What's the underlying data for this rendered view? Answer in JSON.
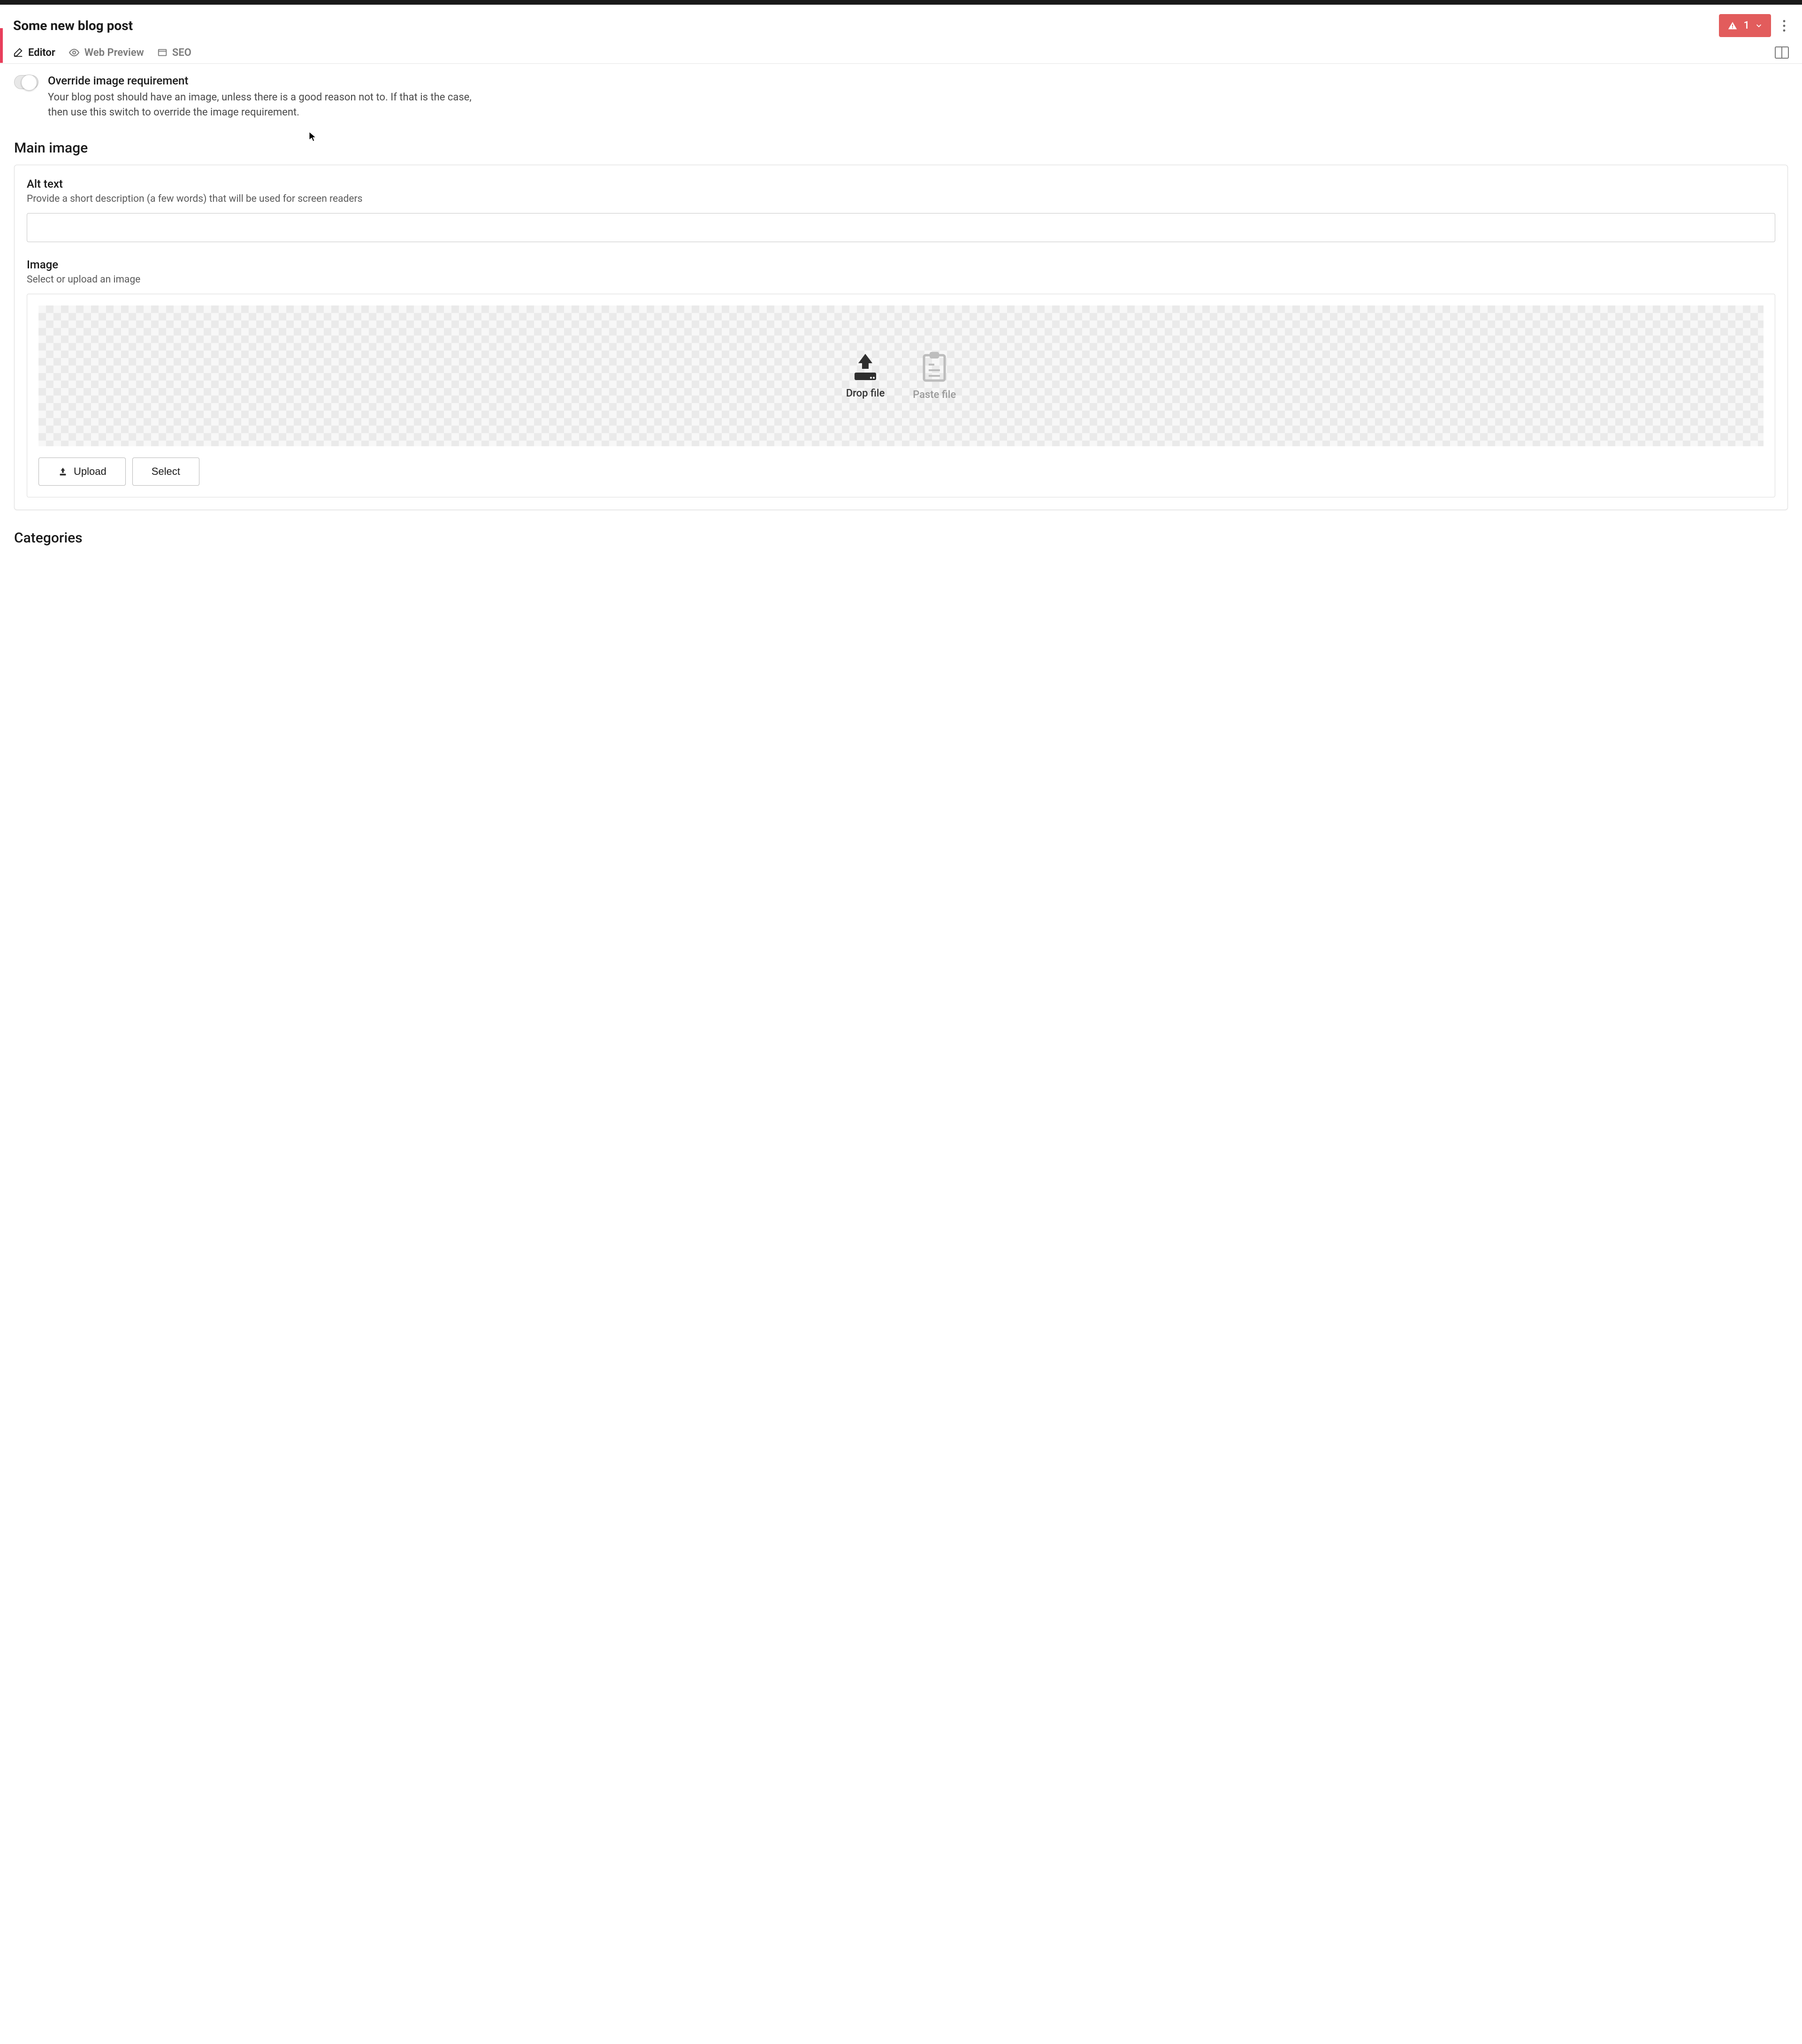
{
  "header": {
    "title": "Some new blog post",
    "warning_count": "1"
  },
  "tabs": {
    "editor": "Editor",
    "web_preview": "Web Preview",
    "seo": "SEO"
  },
  "override": {
    "label": "Override image requirement",
    "description": "Your blog post should have an image, unless there is a good reason not to. If that is the case, then use this switch to override the image requirement."
  },
  "main_image": {
    "section_title": "Main image",
    "alt_text": {
      "label": "Alt text",
      "description": "Provide a short description (a few words) that will be used for screen readers",
      "value": ""
    },
    "image": {
      "label": "Image",
      "description": "Select or upload an image",
      "drop_label": "Drop file",
      "paste_label": "Paste file",
      "upload_label": "Upload",
      "select_label": "Select"
    }
  },
  "categories": {
    "section_title": "Categories"
  }
}
